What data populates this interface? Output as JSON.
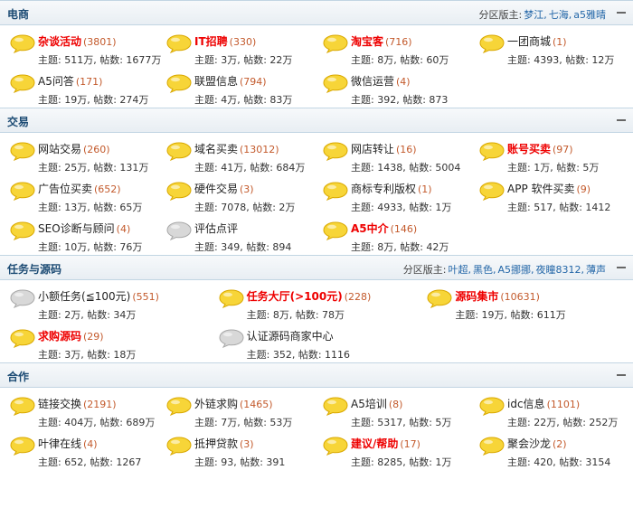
{
  "colors": {
    "bubble_active": "#f7d538",
    "bubble_inactive": "#d8d8d8",
    "highlight_name": "#e00000",
    "count": "#c35a2c",
    "link": "#2467a8"
  },
  "sections": [
    {
      "title": "电商",
      "moderators_label": "分区版主:",
      "moderators": [
        "梦江,",
        "七海,",
        "a5雅晴"
      ],
      "forums": [
        {
          "name": "杂谈活动",
          "count": "(3801)",
          "stats": "主题: 511万, 帖数: 1677万",
          "icon": "bubble-yellow",
          "red": true
        },
        {
          "name": "IT招聘",
          "count": "(330)",
          "stats": "主题: 3万, 帖数: 22万",
          "icon": "bubble-yellow",
          "red": true
        },
        {
          "name": "淘宝客",
          "count": "(716)",
          "stats": "主题: 8万, 帖数: 60万",
          "icon": "bubble-yellow",
          "red": true
        },
        {
          "name": "一团商城",
          "count": "(1)",
          "stats": "主题: 4393, 帖数: 12万",
          "icon": "bubble-yellow",
          "red": false
        },
        {
          "name": "A5问答",
          "count": "(171)",
          "stats": "主题: 19万, 帖数: 274万",
          "icon": "bubble-yellow",
          "red": false
        },
        {
          "name": "联盟信息",
          "count": "(794)",
          "stats": "主题: 4万, 帖数: 83万",
          "icon": "bubble-yellow",
          "red": false
        },
        {
          "name": "微信运营",
          "count": "(4)",
          "stats": "主题: 392, 帖数: 873",
          "icon": "bubble-yellow",
          "red": false
        }
      ]
    },
    {
      "title": "交易",
      "moderators_label": "",
      "moderators": [],
      "forums": [
        {
          "name": "网站交易",
          "count": "(260)",
          "stats": "主题: 25万, 帖数: 131万",
          "icon": "bubble-yellow",
          "red": false
        },
        {
          "name": "域名买卖",
          "count": "(13012)",
          "stats": "主题: 41万, 帖数: 684万",
          "icon": "bubble-yellow",
          "red": false
        },
        {
          "name": "网店转让",
          "count": "(16)",
          "stats": "主题: 1438, 帖数: 5004",
          "icon": "bubble-yellow",
          "red": false
        },
        {
          "name": "账号买卖",
          "count": "(97)",
          "stats": "主题: 1万, 帖数: 5万",
          "icon": "bubble-yellow",
          "red": true
        },
        {
          "name": "广告位买卖",
          "count": "(652)",
          "stats": "主题: 13万, 帖数: 65万",
          "icon": "bubble-yellow",
          "red": false
        },
        {
          "name": "硬件交易",
          "count": "(3)",
          "stats": "主题: 7078, 帖数: 2万",
          "icon": "bubble-yellow",
          "red": false
        },
        {
          "name": "商标专利版权",
          "count": "(1)",
          "stats": "主题: 4933, 帖数: 1万",
          "icon": "bubble-yellow",
          "red": false
        },
        {
          "name": "APP 软件买卖",
          "count": "(9)",
          "stats": "主题: 517, 帖数: 1412",
          "icon": "bubble-yellow",
          "red": false
        },
        {
          "name": "SEO诊断与顾问",
          "count": "(4)",
          "stats": "主题: 10万, 帖数: 76万",
          "icon": "bubble-yellow",
          "red": false
        },
        {
          "name": "评估点评",
          "count": "",
          "stats": "主题: 349, 帖数: 894",
          "icon": "bubble-gray",
          "red": false
        },
        {
          "name": "A5中介",
          "count": "(146)",
          "stats": "主题: 8万, 帖数: 42万",
          "icon": "bubble-yellow",
          "red": true
        }
      ]
    },
    {
      "title": "任务与源码",
      "moderators_label": "分区版主:",
      "moderators": [
        "叶超,",
        "黑色,",
        "A5挪挪,",
        "夜瞳8312,",
        "薄声"
      ],
      "forums": [
        {
          "name": "小额任务(≦100元)",
          "count": "(551)",
          "stats": "主题: 2万, 帖数: 34万",
          "icon": "bubble-gray",
          "red": false
        },
        {
          "name": "任务大厅(>100元)",
          "count": "(228)",
          "stats": "主题: 8万, 帖数: 78万",
          "icon": "bubble-yellow",
          "red": true
        },
        {
          "name": "源码集市",
          "count": "(10631)",
          "stats": "主题: 19万, 帖数: 611万",
          "icon": "bubble-yellow",
          "red": true
        },
        {
          "name": "求购源码",
          "count": "(29)",
          "stats": "主题: 3万, 帖数: 18万",
          "icon": "bubble-yellow",
          "red": true
        },
        {
          "name": "认证源码商家中心",
          "count": "",
          "stats": "主题: 352, 帖数: 1116",
          "icon": "bubble-gray",
          "red": false
        }
      ]
    },
    {
      "title": "合作",
      "moderators_label": "",
      "moderators": [],
      "forums": [
        {
          "name": "链接交换",
          "count": "(2191)",
          "stats": "主题: 404万, 帖数: 689万",
          "icon": "bubble-yellow",
          "red": false
        },
        {
          "name": "外链求购",
          "count": "(1465)",
          "stats": "主题: 7万, 帖数: 53万",
          "icon": "bubble-yellow",
          "red": false
        },
        {
          "name": "A5培训",
          "count": "(8)",
          "stats": "主题: 5317, 帖数: 5万",
          "icon": "bubble-yellow",
          "red": false
        },
        {
          "name": "idc信息",
          "count": "(1101)",
          "stats": "主题: 22万, 帖数: 252万",
          "icon": "bubble-yellow",
          "red": false
        },
        {
          "name": "叶律在线",
          "count": "(4)",
          "stats": "主题: 652, 帖数: 1267",
          "icon": "bubble-yellow",
          "red": false
        },
        {
          "name": "抵押贷款",
          "count": "(3)",
          "stats": "主题: 93, 帖数: 391",
          "icon": "bubble-yellow",
          "red": false
        },
        {
          "name": "建议/帮助",
          "count": "(17)",
          "stats": "主题: 8285, 帖数: 1万",
          "icon": "bubble-yellow",
          "red": true
        },
        {
          "name": "聚会沙龙",
          "count": "(2)",
          "stats": "主题: 420, 帖数: 3154",
          "icon": "bubble-yellow",
          "red": false
        }
      ]
    }
  ]
}
